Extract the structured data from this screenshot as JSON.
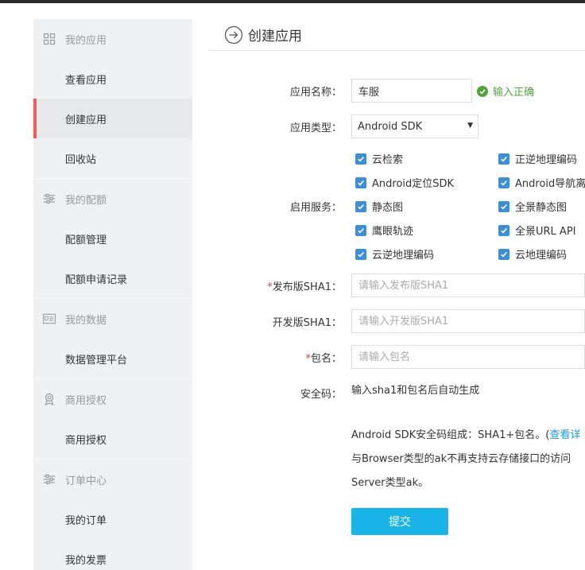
{
  "sidebar": {
    "groups": [
      {
        "title": "我的应用",
        "icon": "grid-icon",
        "items": [
          "查看应用",
          "创建应用",
          "回收站"
        ]
      },
      {
        "title": "我的配额",
        "icon": "sliders-icon",
        "items": [
          "配额管理",
          "配额申请记录"
        ]
      },
      {
        "title": "我的数据",
        "icon": "id-card-icon",
        "items": [
          "数据管理平台"
        ]
      },
      {
        "title": "商用授权",
        "icon": "badge-icon",
        "items": [
          "商用授权"
        ]
      },
      {
        "title": "订单中心",
        "icon": "sliders-icon",
        "items": [
          "我的订单",
          "我的发票"
        ]
      }
    ],
    "active_item": "创建应用",
    "active_color": "#ff5555"
  },
  "page": {
    "title": "创建应用",
    "icon": "arrow-circle-icon"
  },
  "form": {
    "app_name": {
      "label": "应用名称：",
      "value": "车服",
      "valid_text": "输入正确"
    },
    "app_type": {
      "label": "应用类型：",
      "value": "Android SDK"
    },
    "services": {
      "label": "启用服务：",
      "left": [
        "云检索",
        "Android定位SDK",
        "静态图",
        "鹰眼轨迹",
        "云逆地理编码"
      ],
      "right": [
        "正逆地理编码",
        "Android导航离",
        "全景静态图",
        "全景URL API",
        "云地理编码"
      ]
    },
    "release_sha1": {
      "required_mark": "*",
      "label": "发布版SHA1：",
      "placeholder": "请输入发布版SHA1"
    },
    "dev_sha1": {
      "label": "开发版SHA1：",
      "placeholder": "请输入开发版SHA1"
    },
    "package": {
      "required_mark": "*",
      "label": "包名：",
      "placeholder": "请输入包名"
    },
    "security_code": {
      "label": "安全码：",
      "value": "输入sha1和包名后自动生成"
    },
    "note": {
      "line1": "Android SDK安全码组成：SHA1+包名。(",
      "line1_link": "查看详",
      "line2": "与Browser类型的ak不再支持云存储接口的访问",
      "line3": "Server类型ak。"
    },
    "submit_label": "提交"
  },
  "colors": {
    "accent": "#1ab3e8",
    "checkbox": "#3b8fd9",
    "valid": "#52a43a",
    "link": "#1a9ad6"
  }
}
